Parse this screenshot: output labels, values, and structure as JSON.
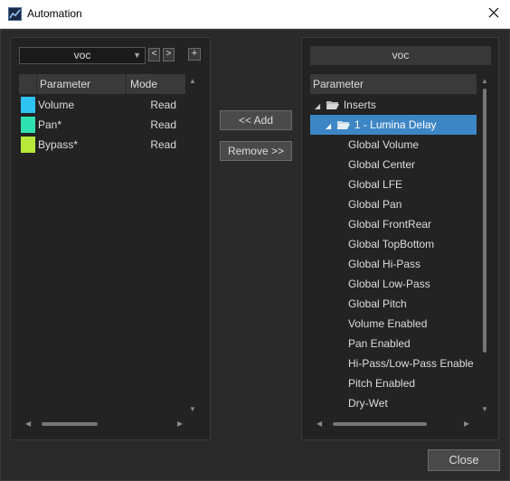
{
  "window": {
    "title": "Automation",
    "close_icon": "close-icon"
  },
  "left": {
    "track_select": "voc",
    "nav_prev": "<",
    "nav_next": ">",
    "add_track": "+",
    "columns": {
      "parameter": "Parameter",
      "mode": "Mode"
    },
    "rows": [
      {
        "name": "Volume",
        "mode": "Read",
        "color": "#2ec3f0"
      },
      {
        "name": "Pan*",
        "mode": "Read",
        "color": "#2fe0b0"
      },
      {
        "name": "Bypass*",
        "mode": "Read",
        "color": "#b8e83a"
      }
    ]
  },
  "middle": {
    "add_label": "<< Add",
    "remove_label": "Remove >>"
  },
  "right": {
    "track_title": "voc",
    "column": "Parameter",
    "tree": {
      "folder": "Inserts",
      "plugin": "1 - Lumina Delay",
      "params": [
        "Global Volume",
        "Global Center",
        "Global LFE",
        "Global Pan",
        "Global FrontRear",
        "Global TopBottom",
        "Global Hi-Pass",
        "Global Low-Pass",
        "Global Pitch",
        "Volume Enabled",
        "Pan Enabled",
        "Hi-Pass/Low-Pass Enable",
        "Pitch Enabled",
        "Dry-Wet"
      ]
    }
  },
  "footer": {
    "close_label": "Close"
  },
  "colors": {
    "selection": "#3d86c6"
  }
}
